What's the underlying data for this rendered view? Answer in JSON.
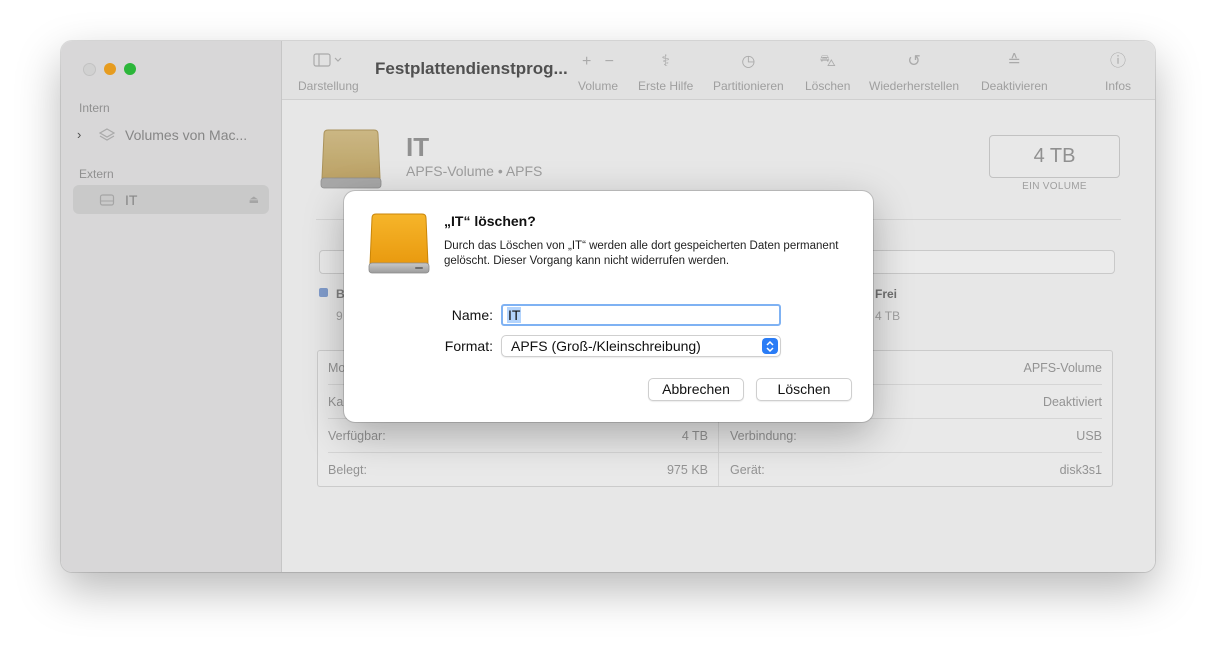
{
  "window": {
    "title": "Festplattendienstprog...",
    "traffic_colors": {
      "close": "#dfdfdf",
      "minimize": "#f5a623",
      "maximize": "#2fc23e"
    }
  },
  "sidebar": {
    "section_intern": "Intern",
    "item_internal": "Volumes von Mac...",
    "section_extern": "Extern",
    "item_external": "IT"
  },
  "toolbar": {
    "view_label": "Darstellung",
    "volume_label": "Volume",
    "firstaid_label": "Erste Hilfe",
    "partition_label": "Partitionieren",
    "erase_label": "Löschen",
    "restore_label": "Wiederherstellen",
    "unmount_label": "Deaktivieren",
    "info_label": "Infos"
  },
  "volume": {
    "name": "IT",
    "subtitle": "APFS-Volume • APFS",
    "capacity": "4 TB",
    "capacity_sub": "EIN VOLUME",
    "legend_used_label": "B",
    "legend_used_value": "9",
    "legend_free_label": "Frei",
    "legend_free_value": "4 TB",
    "used_color": "#8aa6d8"
  },
  "info": {
    "r1_left_label": "Mo",
    "r1_right_value": "APFS-Volume",
    "r2_left_label": "Ka",
    "r2_right_value": "Deaktiviert",
    "r3_left_label": "Verfügbar:",
    "r3_left_value": "4 TB",
    "r3_right_label": "Verbindung:",
    "r3_right_value": "USB",
    "r4_left_label": "Belegt:",
    "r4_left_value": "975 KB",
    "r4_right_label": "Gerät:",
    "r4_right_value": "disk3s1"
  },
  "dialog": {
    "title": "„IT“ löschen?",
    "message": "Durch das Löschen von „IT“ werden alle dort gespeicherten Daten permanent gelöscht. Dieser Vorgang kann nicht widerrufen werden.",
    "name_label": "Name:",
    "name_value": "IT",
    "format_label": "Format:",
    "format_value": "APFS (Groß-/Kleinschreibung)",
    "cancel_label": "Abbrechen",
    "erase_label": "Löschen",
    "accent_color": "#2a7cf6",
    "drive_color": "#f0a818"
  }
}
